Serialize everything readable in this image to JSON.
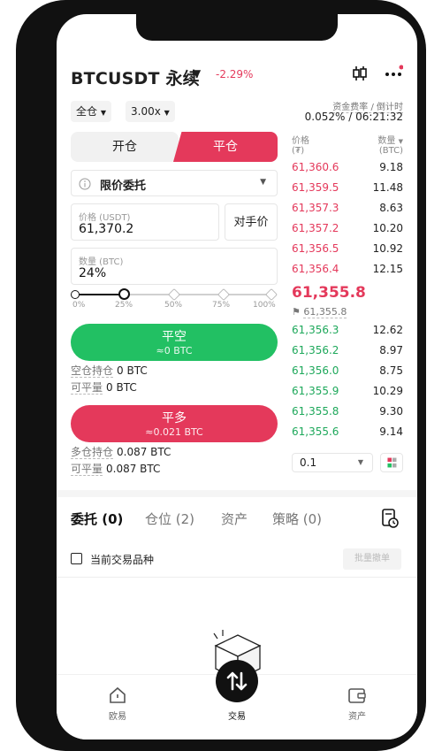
{
  "header": {
    "symbol": "BTCUSDT 永续",
    "change": "-2.29%",
    "funding_label": "资金费率 / 倒计时",
    "funding_value": "0.052% / 06:21:32"
  },
  "controls": {
    "margin_mode": "全仓",
    "leverage": "3.00x"
  },
  "tabs": {
    "open": "开仓",
    "close": "平仓"
  },
  "order_type": "限价委托",
  "price": {
    "label": "价格 (USDT)",
    "value": "61,370.2",
    "counterparty": "对手价"
  },
  "quantity": {
    "label": "数量 (BTC)",
    "value": "24%"
  },
  "slider": {
    "level_percent": 25,
    "marks": [
      "0%",
      "25%",
      "50%",
      "75%",
      "100%"
    ]
  },
  "close_short": {
    "label": "平空",
    "sub": "≈0 BTC",
    "hold_label": "空仓持仓",
    "hold_value": "0 BTC",
    "closable_label": "可平量",
    "closable_value": "0 BTC"
  },
  "close_long": {
    "label": "平多",
    "sub": "≈0.021 BTC",
    "hold_label": "多仓持仓",
    "hold_value": "0.087 BTC",
    "closable_label": "可平量",
    "closable_value": "0.087 BTC"
  },
  "orderbook": {
    "price_header": "价格",
    "price_unit": "(₮)",
    "qty_header": "数量",
    "qty_unit": "(BTC)",
    "asks": [
      {
        "p": "61,360.6",
        "q": "9.18"
      },
      {
        "p": "61,359.5",
        "q": "11.48"
      },
      {
        "p": "61,357.3",
        "q": "8.63"
      },
      {
        "p": "61,357.2",
        "q": "10.20"
      },
      {
        "p": "61,356.5",
        "q": "10.92"
      },
      {
        "p": "61,356.4",
        "q": "12.15"
      }
    ],
    "last_price": "61,355.8",
    "mark_price": "61,355.8",
    "bids": [
      {
        "p": "61,356.3",
        "q": "12.62"
      },
      {
        "p": "61,356.2",
        "q": "8.97"
      },
      {
        "p": "61,356.0",
        "q": "8.75"
      },
      {
        "p": "61,355.9",
        "q": "10.29"
      },
      {
        "p": "61,355.8",
        "q": "9.30"
      },
      {
        "p": "61,355.6",
        "q": "9.14"
      }
    ],
    "depth": "0.1"
  },
  "bottom_tabs": [
    "委托 (0)",
    "仓位 (2)",
    "资产",
    "策略 (0)"
  ],
  "filter": {
    "label": "当前交易品种",
    "batch": "批量撤单"
  },
  "nav": {
    "left": "欧易",
    "center": "交易",
    "right": "资产"
  },
  "colors": {
    "red": "#e4395b",
    "green": "#22c063"
  }
}
